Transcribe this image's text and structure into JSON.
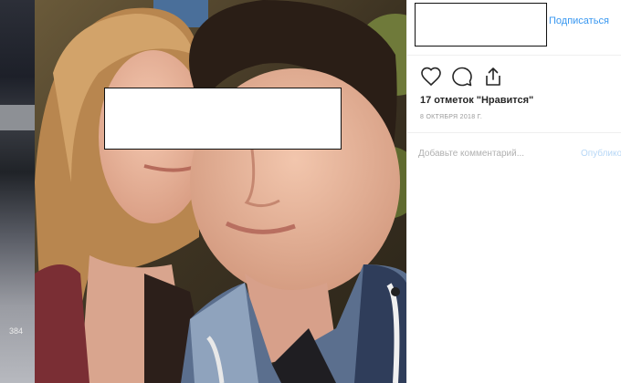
{
  "post": {
    "follow_label": "Подписаться",
    "likes_text": "17 отметок \"Нравится\"",
    "date_text": "8 ОКТЯБРЯ 2018 Г.",
    "comment_placeholder": "Добавьте комментарий...",
    "publish_label": "Опубликовать"
  },
  "left_strip": {
    "counter_text": "384"
  },
  "colors": {
    "accent": "#3897f0",
    "publish_disabled": "#b7d7f6",
    "border": "#efefef",
    "text": "#262626",
    "muted": "#999999"
  },
  "icons": {
    "like": "heart-icon",
    "comment": "comment-icon",
    "share": "share-icon"
  }
}
